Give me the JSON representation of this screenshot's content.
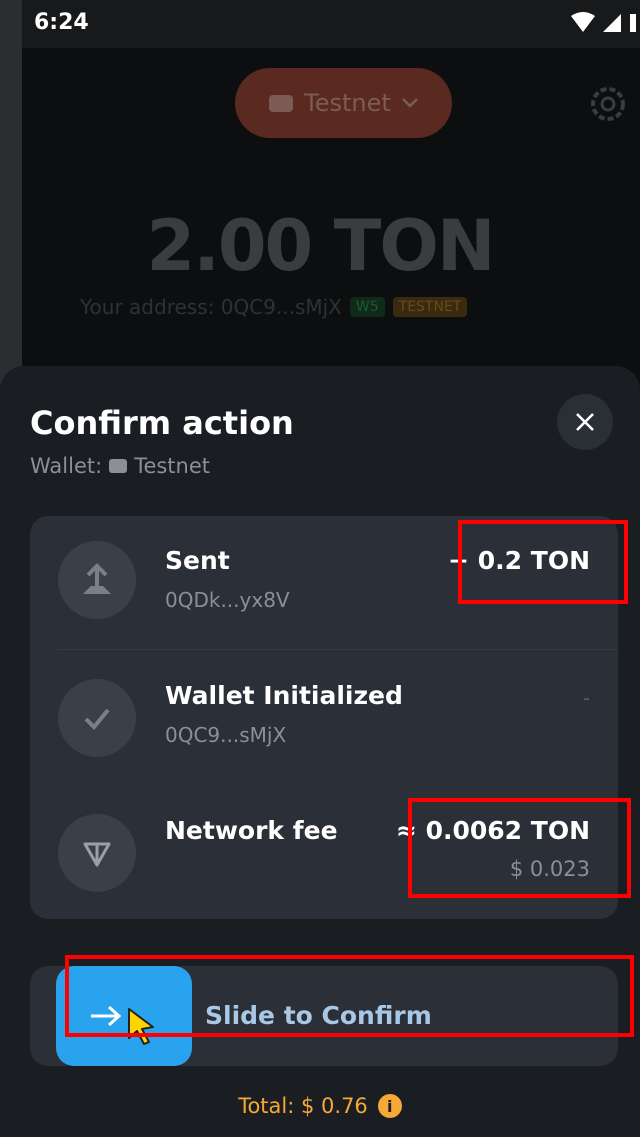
{
  "status": {
    "time": "6:24"
  },
  "background": {
    "network_label": "Testnet",
    "balance": "2.00 TON",
    "address_text": "Your address: 0QC9...sMjX",
    "tag_w5": "W5",
    "tag_testnet": "TESTNET"
  },
  "sheet": {
    "title": "Confirm action",
    "wallet_prefix": "Wallet:",
    "wallet_name": "Testnet"
  },
  "actions": [
    {
      "title": "Sent",
      "subtitle": "0QDk...yx8V",
      "amount": "− 0.2 TON",
      "icon": "arrow-up-icon"
    },
    {
      "title": "Wallet Initialized",
      "subtitle": "0QC9...sMjX",
      "amount": "-",
      "icon": "check-icon"
    },
    {
      "title": "Network fee",
      "subtitle": "",
      "amount": "≈ 0.0062 TON",
      "usd": "$ 0.023",
      "icon": "ton-icon"
    }
  ],
  "confirm": {
    "label": "Slide to Confirm"
  },
  "total": {
    "text": "Total: $ 0.76"
  },
  "colors": {
    "accent": "#2aa3ee",
    "total": "#f6a935",
    "highlight": "#ff0000"
  }
}
